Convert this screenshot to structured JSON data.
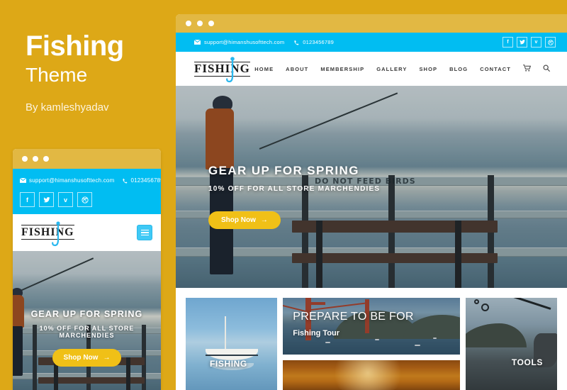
{
  "left_panel": {
    "title": "Fishing",
    "subtitle": "Theme",
    "author": "By kamleshyadav",
    "background_color": "#dda817"
  },
  "colors": {
    "gold": "#dda817",
    "gold_titlebar": "#e2b843",
    "cyan": "#01bdf2",
    "button_gold": "#f0c017",
    "text_dark": "#3a3a3a"
  },
  "window_chrome": {
    "dots": [
      "dot-1",
      "dot-2",
      "dot-3"
    ]
  },
  "topbar": {
    "email": "support@himanshusofttech.com",
    "phone": "0123456789",
    "email_icon": "envelope-icon",
    "phone_icon": "phone-icon",
    "social": [
      {
        "name": "facebook-icon",
        "glyph": "f"
      },
      {
        "name": "twitter-icon",
        "glyph": "ᵥ"
      },
      {
        "name": "vimeo-icon",
        "glyph": "v"
      },
      {
        "name": "dribbble-icon",
        "glyph": "◎"
      }
    ]
  },
  "logo": {
    "text_before": "FISH",
    "text_after": "NG",
    "full_text": "FISHING",
    "hook_icon": "fish-hook-icon"
  },
  "nav": {
    "items": [
      {
        "label": "HOME"
      },
      {
        "label": "ABOUT"
      },
      {
        "label": "MEMBERSHIP"
      },
      {
        "label": "GALLERY"
      },
      {
        "label": "SHOP"
      },
      {
        "label": "BLOG"
      },
      {
        "label": "CONTACT"
      }
    ],
    "cart_icon": "shopping-cart-icon",
    "search_icon": "search-icon",
    "cart_glyph": "🛒",
    "search_glyph": "⌕"
  },
  "mobile": {
    "menu_icon": "hamburger-menu-icon"
  },
  "hero": {
    "headline": "GEAR UP FOR SPRING",
    "subheadline": "10% OFF FOR ALL STORE MARCHENDIES",
    "button_label": "Shop Now",
    "button_arrow": "→",
    "sign_text": "DO NOT FEED BIRDS"
  },
  "cards": [
    {
      "name": "card-fishing",
      "label": "FISHING",
      "image_subject": "sailboat-on-calm-water"
    },
    {
      "name": "card-fishing-tour",
      "title": "PREPARE TO BE FOR",
      "subtitle": "Fishing Tour",
      "image_subject": "golden-gate-bridge-bay"
    },
    {
      "name": "card-sunset",
      "label": "",
      "image_subject": "orange-sunset-water"
    },
    {
      "name": "card-tools",
      "label": "TOOLS",
      "image_subject": "hand-holding-fishing-rod"
    }
  ]
}
